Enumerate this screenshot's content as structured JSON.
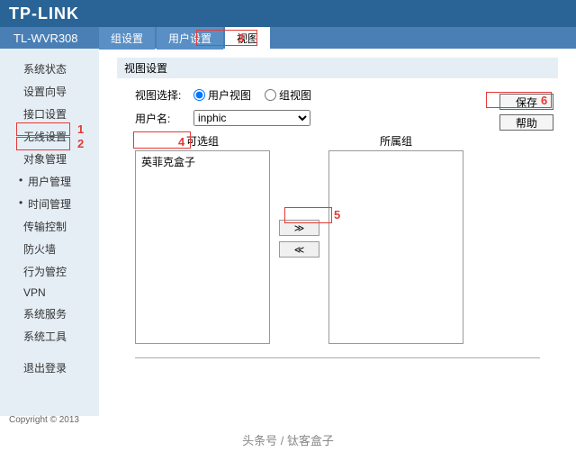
{
  "header": {
    "logo": "TP-LINK",
    "model": "TL-WVR308"
  },
  "tabs": [
    {
      "label": "组设置"
    },
    {
      "label": "用户设置"
    },
    {
      "label": "视图"
    }
  ],
  "sidebar": {
    "items": [
      "系统状态",
      "设置向导",
      "接口设置",
      "无线设置",
      "对象管理",
      "用户管理",
      "时间管理",
      "传输控制",
      "防火墙",
      "行为管控",
      "VPN",
      "系统服务",
      "系统工具"
    ],
    "logout": "退出登录"
  },
  "panel": {
    "title": "视图设置",
    "view_select_label": "视图选择:",
    "radio_user": "用户视图",
    "radio_group": "组视图",
    "username_label": "用户名:",
    "username_value": "inphic",
    "available_title": "可选组",
    "belong_title": "所属组",
    "available_items": [
      "英菲克盒子"
    ],
    "move_right": "≫",
    "move_left": "≪",
    "save": "保存",
    "help": "帮助"
  },
  "annotations": {
    "n1": "1",
    "n2": "2",
    "n3": "3",
    "n4": "4",
    "n5": "5",
    "n6": "6"
  },
  "footer": {
    "copyright": "Copyright © 2013",
    "watermark": "头条号 / 钛客盒子"
  }
}
